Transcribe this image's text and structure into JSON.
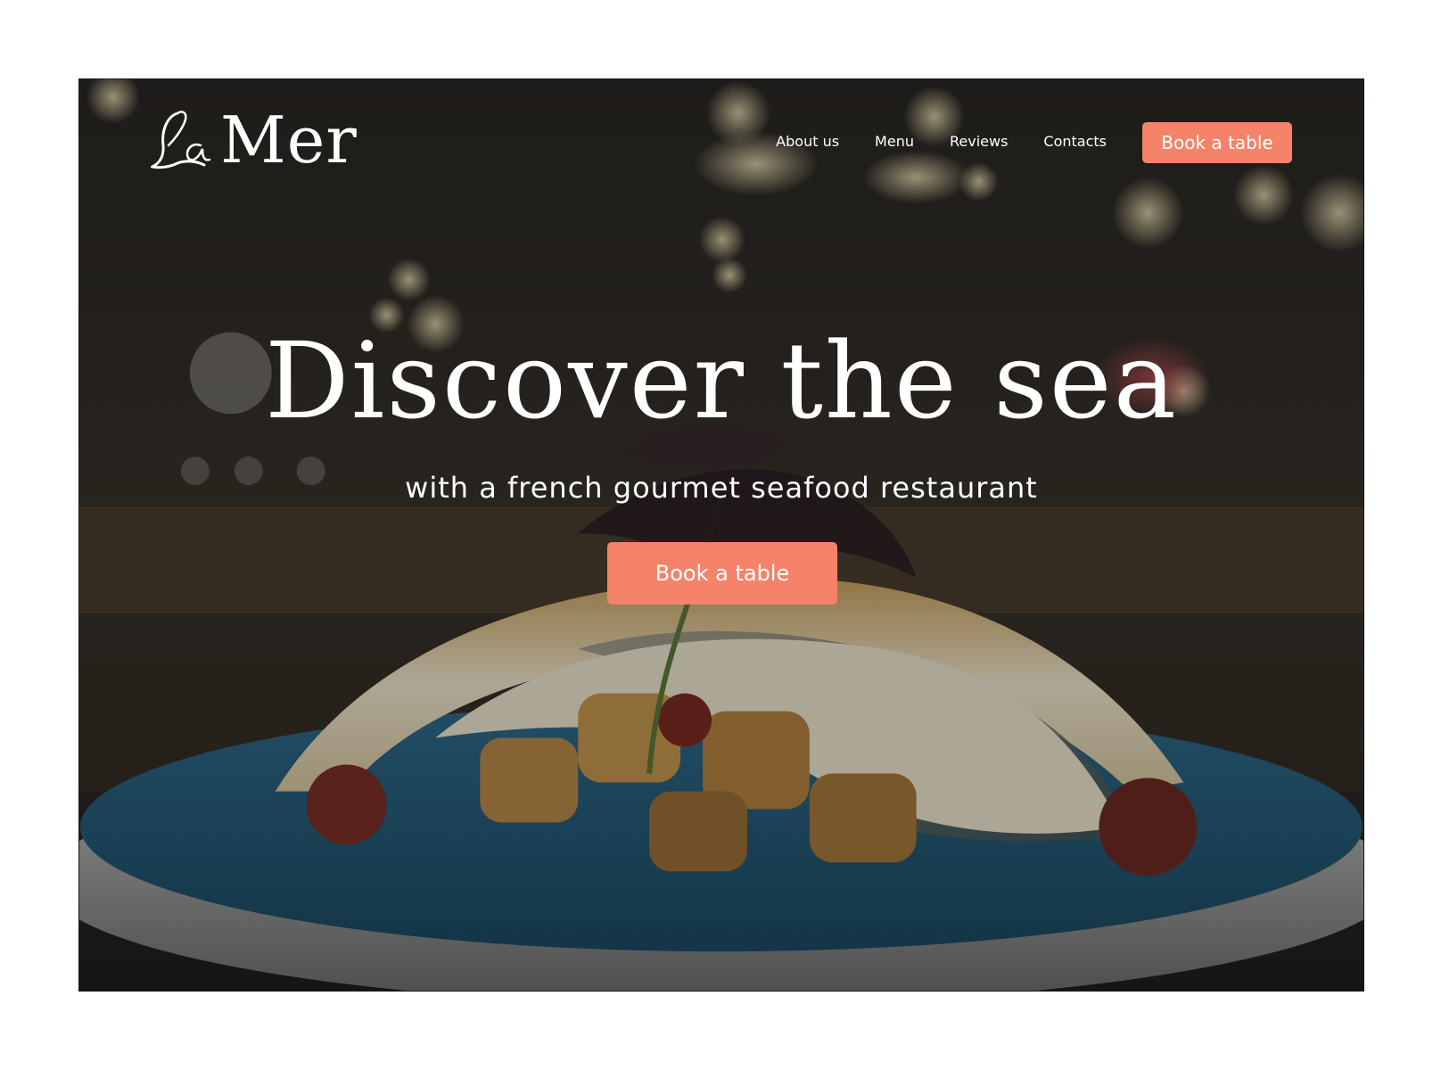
{
  "brand": {
    "name_script": "La",
    "name": "Mer"
  },
  "nav": {
    "links": [
      {
        "label": "About us"
      },
      {
        "label": "Menu"
      },
      {
        "label": "Reviews"
      },
      {
        "label": "Contacts"
      }
    ],
    "cta_label": "Book a table"
  },
  "hero": {
    "headline": "Discover the sea",
    "subheadline": "with a french gourmet seafood restaurant",
    "cta_label": "Book a table",
    "image_subject": "plated sea bass fillet on roasted potatoes with microgreens, blurred restaurant background"
  },
  "colors": {
    "accent": "#f4836a",
    "text_on_dark": "#ffffff",
    "page_background": "#ffffff"
  }
}
